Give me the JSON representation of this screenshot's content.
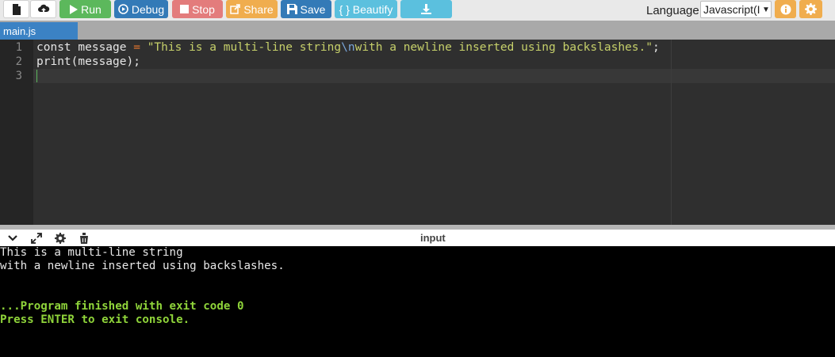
{
  "toolbar": {
    "run_label": "Run",
    "debug_label": "Debug",
    "stop_label": "Stop",
    "share_label": "Share",
    "save_label": "Save",
    "beautify_label": "{ } Beautify",
    "language_label": "Language",
    "language_value": "Javascript(I"
  },
  "tabs": [
    {
      "label": "main.js"
    }
  ],
  "editor": {
    "line_numbers": [
      "1",
      "2",
      "3"
    ],
    "line1": {
      "p1": "const message ",
      "p2": "=",
      "p3": " ",
      "p4": "\"This is a multi-line string",
      "p5": "\\n",
      "p6": "with a newline inserted using backslashes.\"",
      "p7": ";"
    },
    "line2": "print(message);"
  },
  "io": {
    "title": "input",
    "output_lines": [
      "This is a multi-line string",
      "with a newline inserted using backslashes."
    ],
    "finished": "...Program finished with exit code 0",
    "press_enter": "Press ENTER to exit console."
  },
  "colors": {
    "run": "#5cb85c",
    "debug": "#337ab7",
    "stop": "#e37c7c",
    "share": "#f0ad4e",
    "save": "#337ab7",
    "beautify": "#5bc0de",
    "tab": "#3b82c4",
    "console_success": "#8fd43a"
  },
  "icons": {
    "new_file": "file-icon",
    "upload": "cloud-upload-icon",
    "run": "play-icon",
    "debug": "debug-circle-icon",
    "stop": "stop-square-icon",
    "share": "share-icon",
    "save": "floppy-disk-icon",
    "download": "download-icon",
    "info": "info-icon",
    "settings": "gear-icon",
    "collapse": "chevron-down-icon",
    "expand": "expand-icon",
    "io_settings": "gear-icon",
    "clear": "eraser-icon"
  }
}
